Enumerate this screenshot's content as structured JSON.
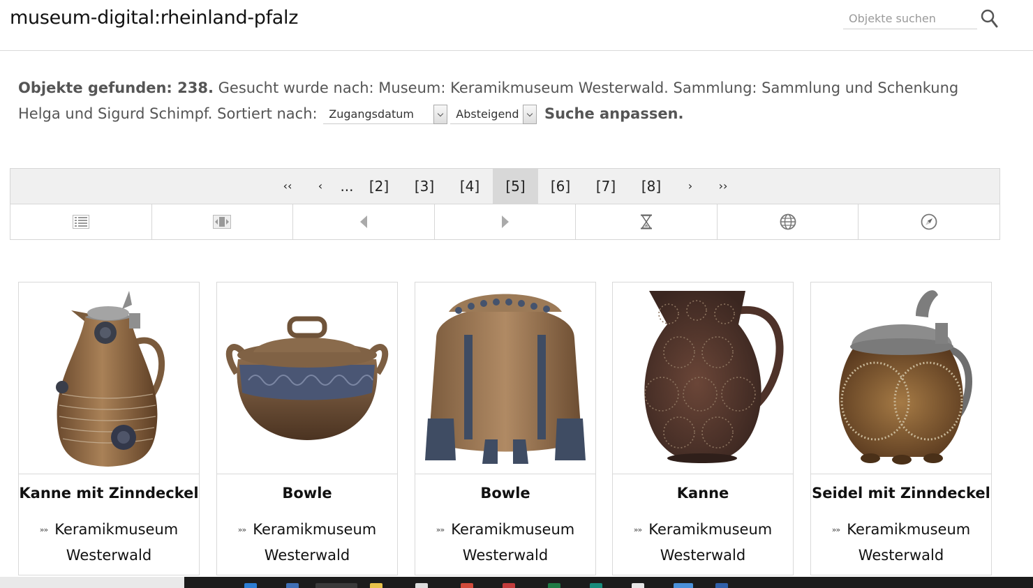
{
  "header": {
    "site_title": "museum-digital:rheinland-pfalz",
    "search_placeholder": "Objekte suchen"
  },
  "summary": {
    "found_label": "Objekte gefunden: 238.",
    "query_text": "Gesucht wurde nach: Museum: Keramikmuseum Westerwald. Sammlung: Sammlung und Schenkung Helga und Sigurd Schimpf. Sortiert nach:",
    "sort_field": "Zugangsdatum",
    "sort_order": "Absteigend",
    "adjust_link": "Suche anpassen."
  },
  "pagination": {
    "first": "‹‹",
    "prev": "‹",
    "ellipsis": "...",
    "pages": [
      "[2]",
      "[3]",
      "[4]",
      "[5]",
      "[6]",
      "[7]",
      "[8]"
    ],
    "current": "[5]",
    "next": "›",
    "last": "››"
  },
  "toolbar": {
    "tools": [
      "list-view-icon",
      "gallery-view-icon",
      "previous-icon",
      "next-icon",
      "timeline-icon",
      "map-icon",
      "compass-icon"
    ]
  },
  "cards": [
    {
      "title": "Kanne mit Zinndeckel",
      "museum_line1": "Keramikmuseum",
      "museum_line2": "Westerwald",
      "marker": "»»"
    },
    {
      "title": "Bowle",
      "museum_line1": "Keramikmuseum",
      "museum_line2": "Westerwald",
      "marker": "»»"
    },
    {
      "title": "Bowle",
      "museum_line1": "Keramikmuseum",
      "museum_line2": "Westerwald",
      "marker": "»»"
    },
    {
      "title": "Kanne",
      "museum_line1": "Keramikmuseum",
      "museum_line2": "Westerwald",
      "marker": "»»"
    },
    {
      "title": "Seidel mit Zinndeckel",
      "museum_line1": "Keramikmuseum",
      "museum_line2": "Westerwald",
      "marker": "»»"
    }
  ],
  "colors": {
    "pager_bg": "#f0f0f0",
    "pager_active": "#d8d8d8",
    "border": "#d6d6d6",
    "text_muted": "#555555"
  }
}
